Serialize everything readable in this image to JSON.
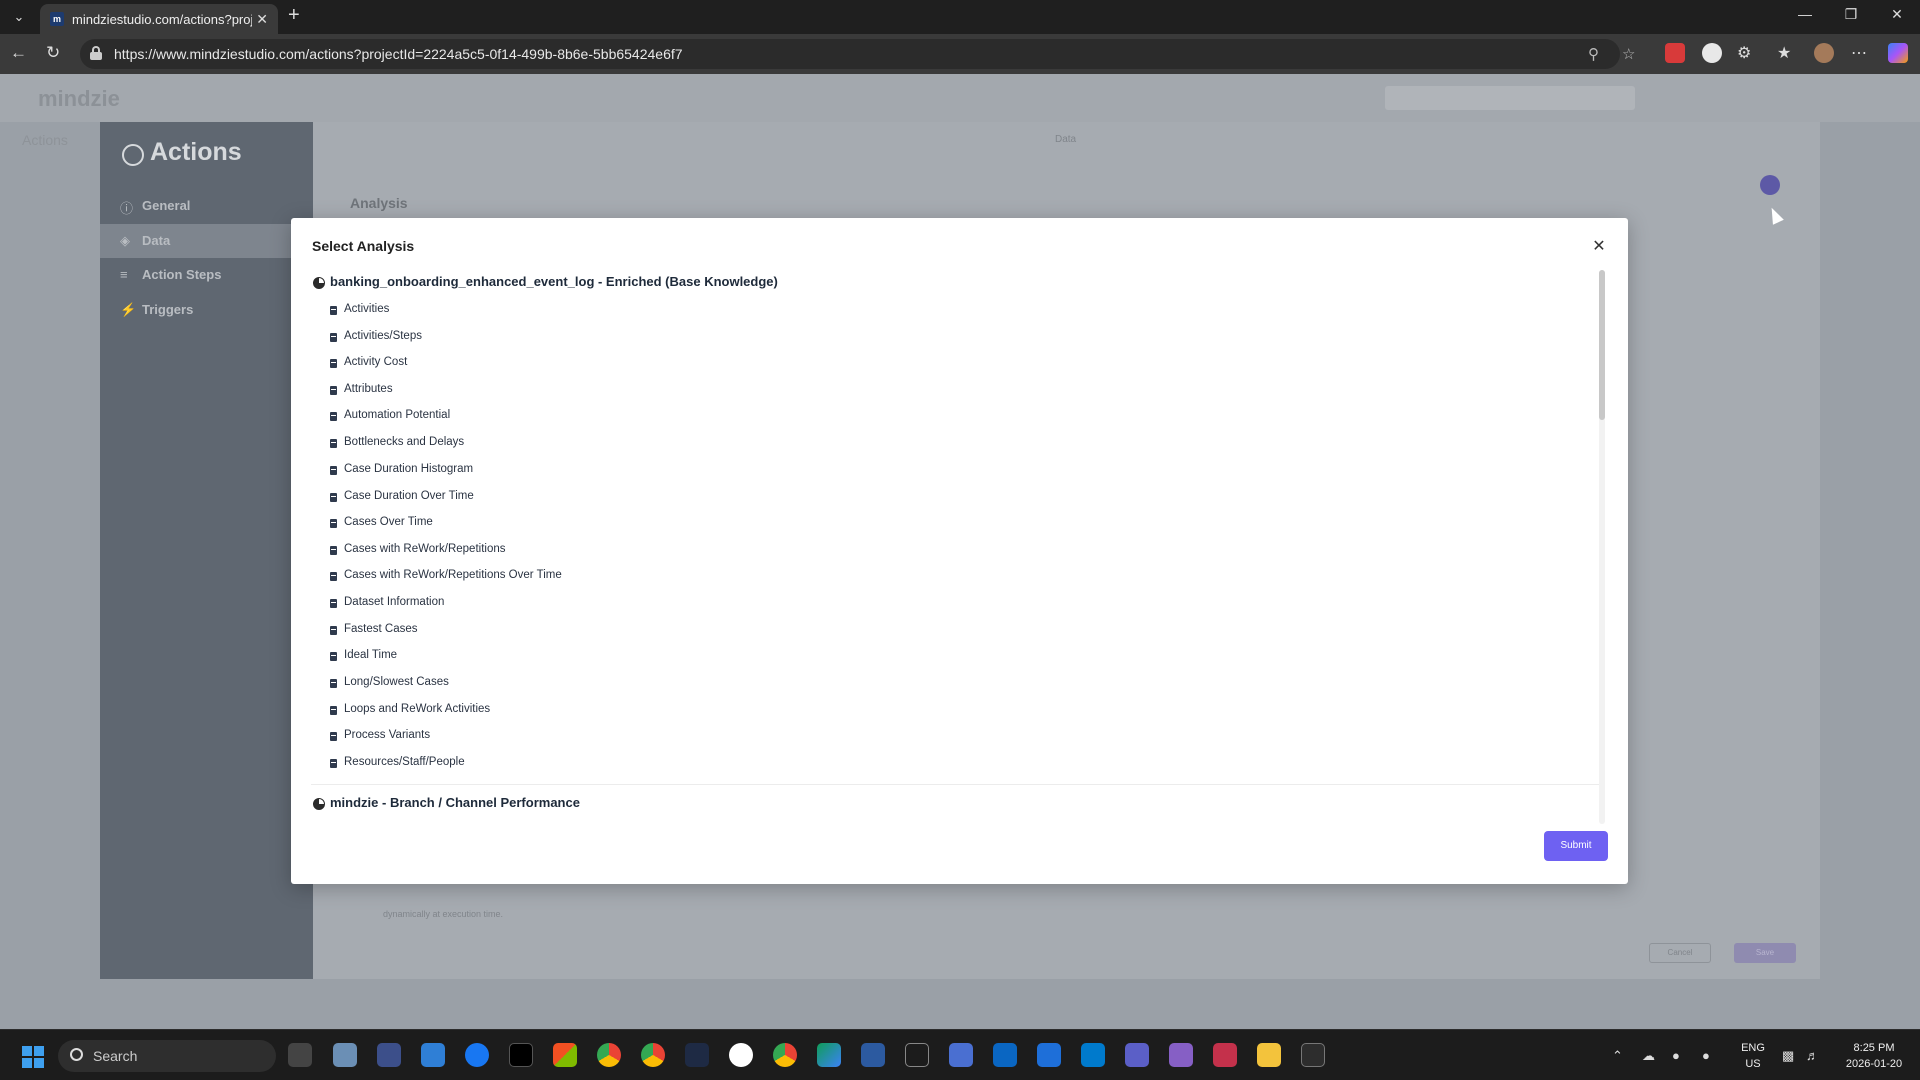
{
  "browser": {
    "tab_title": "mindziestudio.com/actions?proje",
    "url": "https://www.mindziestudio.com/actions?projectId=2224a5c5-0f14-499b-8b6e-5bb65424e6f7"
  },
  "app": {
    "logo": "mindzie",
    "breadcrumb": "Actions"
  },
  "panel": {
    "title": "Actions",
    "tab_title": "Data",
    "section_title": "Analysis",
    "hint": "dynamically at execution time.",
    "cancel_label": "Cancel",
    "save_label": "Save",
    "sidebar": [
      {
        "label": "General",
        "icon": "info-icon"
      },
      {
        "label": "Data",
        "icon": "data-icon"
      },
      {
        "label": "Action Steps",
        "icon": "steps-icon"
      },
      {
        "label": "Triggers",
        "icon": "bolt-icon"
      }
    ]
  },
  "modal": {
    "title": "Select Analysis",
    "submit_label": "Submit",
    "groups": [
      {
        "name": "banking_onboarding_enhanced_event_log - Enriched (Base Knowledge)",
        "items": [
          "Activities",
          "Activities/Steps",
          "Activity Cost",
          "Attributes",
          "Automation Potential",
          "Bottlenecks and Delays",
          "Case Duration Histogram",
          "Case Duration Over Time",
          "Cases Over Time",
          "Cases with ReWork/Repetitions",
          "Cases with ReWork/Repetitions Over Time",
          "Dataset Information",
          "Fastest Cases",
          "Ideal Time",
          "Long/Slowest Cases",
          "Loops and ReWork Activities",
          "Process Variants",
          "Resources/Staff/People"
        ]
      },
      {
        "name": "mindzie - Branch / Channel Performance",
        "items": []
      }
    ]
  },
  "taskbar": {
    "search_placeholder": "Search",
    "lang": "ENG",
    "region": "US",
    "time": "8:25 PM",
    "date": "2026-01-20"
  },
  "colors": {
    "accent": "#6e61f2",
    "sidebar_bg": "#5f6771"
  }
}
